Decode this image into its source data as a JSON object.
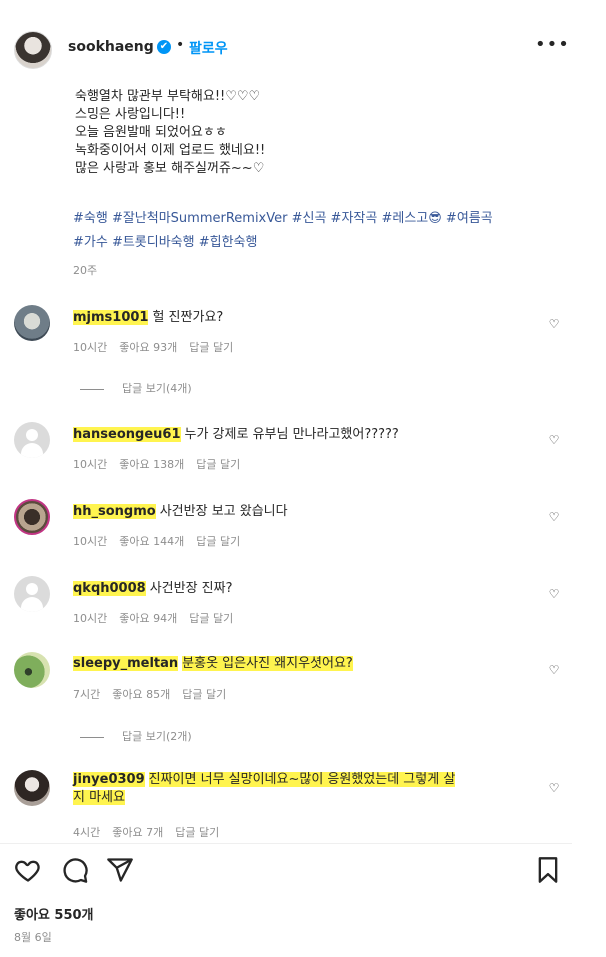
{
  "header": {
    "username": "sookhaeng",
    "verified_icon": "✔",
    "separator": "•",
    "follow_label": "팔로우",
    "more_label": "•••"
  },
  "caption": {
    "lines": [
      "숙행열차 많관부 부탁해요!!♡♡♡",
      "스밍은 사랑입니다!!",
      "오늘 음원발매 되었어요ㅎㅎ",
      "녹화중이어서 이제 업로드 했네요!!",
      "많은 사랑과 홍보 해주실꺼쥬~~♡"
    ],
    "hashtags_line1": "#숙행 #잘난척마SummerRemixVer #신곡 #자작곡 #레스고😎 #여름곡",
    "hashtags_line2": "#가수 #트롯디바숙행 #힙한숙행",
    "time": "20주"
  },
  "comments": [
    {
      "user": "mjms1001",
      "text": "헐 진짠가요?",
      "time": "10시간",
      "likes": "좋아요 93개",
      "reply": "답글 달기",
      "view_replies": "답글 보기(4개)"
    },
    {
      "user": "hanseongeu61",
      "text": "누가 강제로 유부님 만나라고했어?????",
      "time": "10시간",
      "likes": "좋아요 138개",
      "reply": "답글 달기"
    },
    {
      "user": "hh_songmo",
      "text": "사건반장 보고 왔습니다",
      "time": "10시간",
      "likes": "좋아요 144개",
      "reply": "답글 달기"
    },
    {
      "user": "qkqh0008",
      "text": "사건반장 진짜?",
      "time": "10시간",
      "likes": "좋아요 94개",
      "reply": "답글 달기"
    },
    {
      "user": "sleepy_meltan",
      "text": "분홍옷 입은사진 왜지우셧어요?",
      "time": "7시간",
      "likes": "좋아요 85개",
      "reply": "답글 달기",
      "view_replies": "답글 보기(2개)"
    },
    {
      "user": "jinye0309",
      "text_line1": "진짜이면 너무 실망이네요~많이 응원했었는데 그렇게 살",
      "text_line2": "지 마세요",
      "time": "4시간",
      "likes": "좋아요 7개",
      "reply": "답글 달기"
    }
  ],
  "footer": {
    "like_count": "좋아요 550개",
    "date": "8월 6일"
  }
}
